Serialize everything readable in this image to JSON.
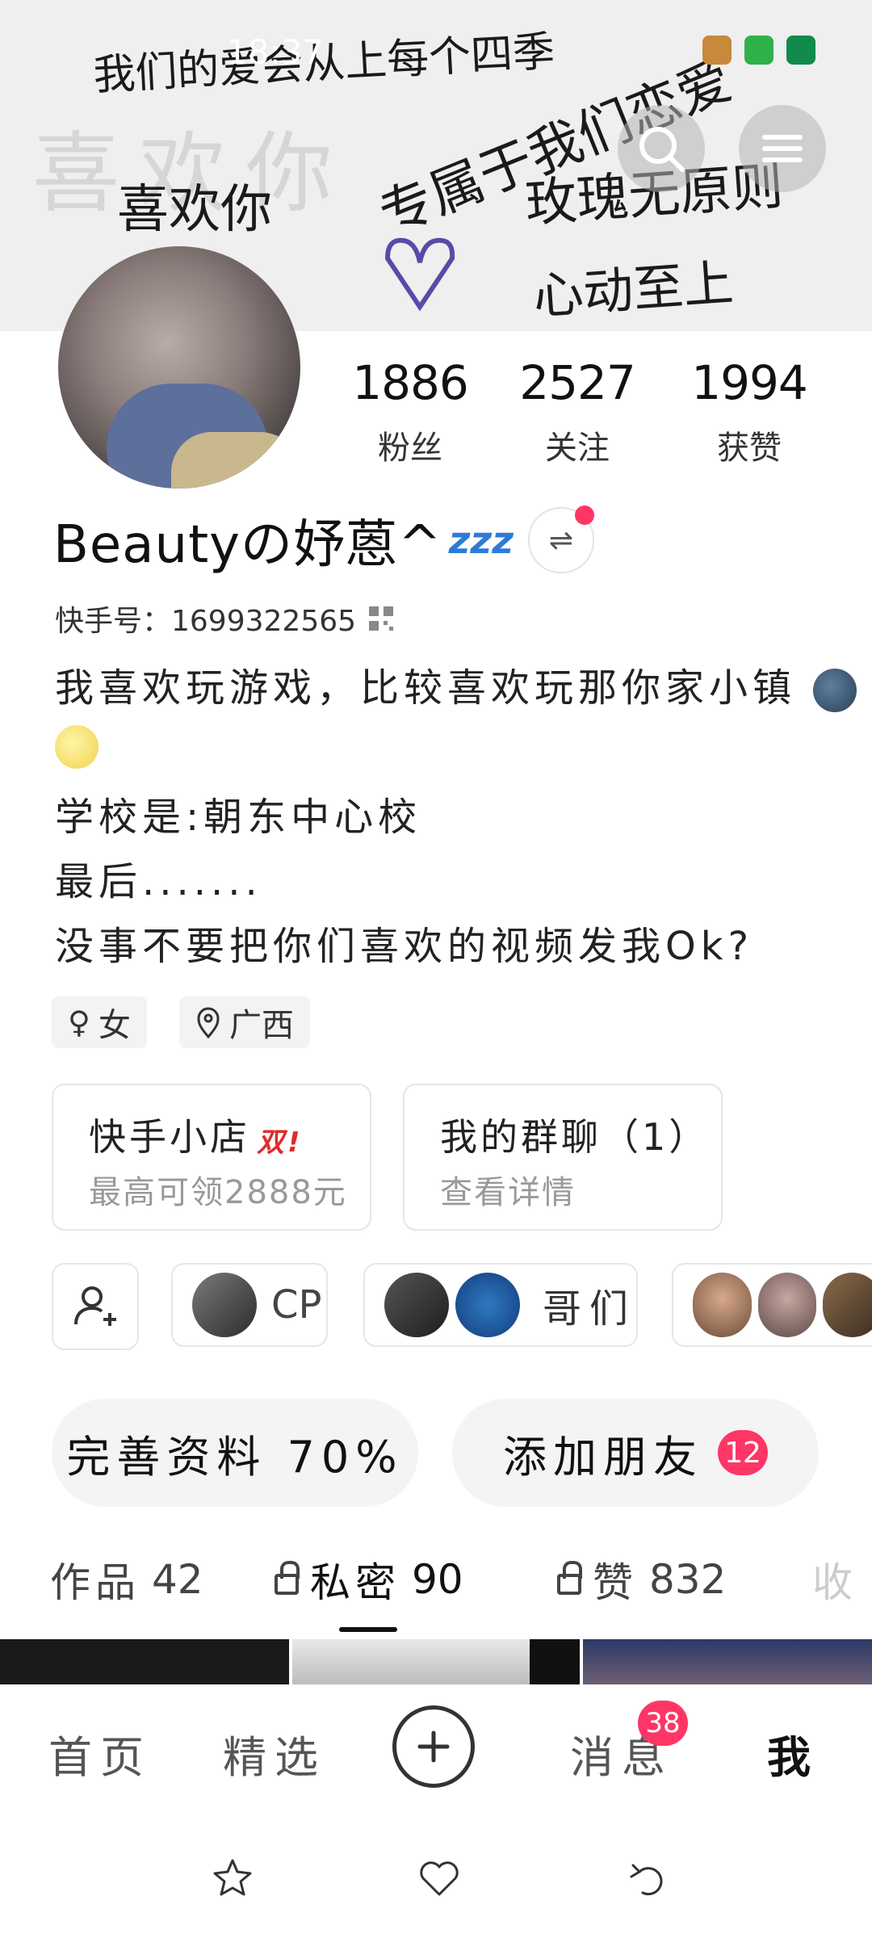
{
  "status_bar": {
    "time": "18:37"
  },
  "banner": {
    "handwriting": [
      "我们的爱会从上每个四季",
      "喜欢你",
      "专属于我们恋爱",
      "玫瑰无原则",
      "心动至上",
      "喜欢你"
    ]
  },
  "profile": {
    "stats": [
      {
        "value": "1886",
        "label": "粉丝"
      },
      {
        "value": "2527",
        "label": "关注"
      },
      {
        "value": "1994",
        "label": "获赞"
      }
    ],
    "name": "Beautyの妤蒽^",
    "name_emoji": "zzz",
    "kuaishou_id": "快手号：1699322565",
    "bio": [
      "我喜欢玩游戏，比较喜欢玩那你家小镇",
      "学校是:朝东中心校",
      "最后.......",
      "没事不要把你们喜欢的视频发我Ok?"
    ],
    "tags": {
      "gender": "女",
      "location": "广西"
    }
  },
  "cards": [
    {
      "title": "快手小店",
      "badge": "双!",
      "subtitle": "最高可领2888元"
    },
    {
      "title": "我的群聊（1）",
      "subtitle": "查看详情"
    }
  ],
  "chips": [
    {
      "label": "CP"
    },
    {
      "label": "哥们"
    }
  ],
  "actions": {
    "complete_profile": "完善资料 70%",
    "add_friends": "添加朋友",
    "add_friends_count": "12"
  },
  "content_tabs": [
    {
      "label": "作品",
      "count": "42"
    },
    {
      "label": "私密",
      "count": "90"
    },
    {
      "label": "赞",
      "count": "832"
    },
    {
      "label": "收"
    }
  ],
  "bottom_nav": {
    "home": "首页",
    "featured": "精选",
    "messages": "消息",
    "messages_badge": "38",
    "me": "我"
  },
  "colors": {
    "accent": "#fe3666",
    "background": "#ffffff",
    "muted_text": "#999999"
  }
}
